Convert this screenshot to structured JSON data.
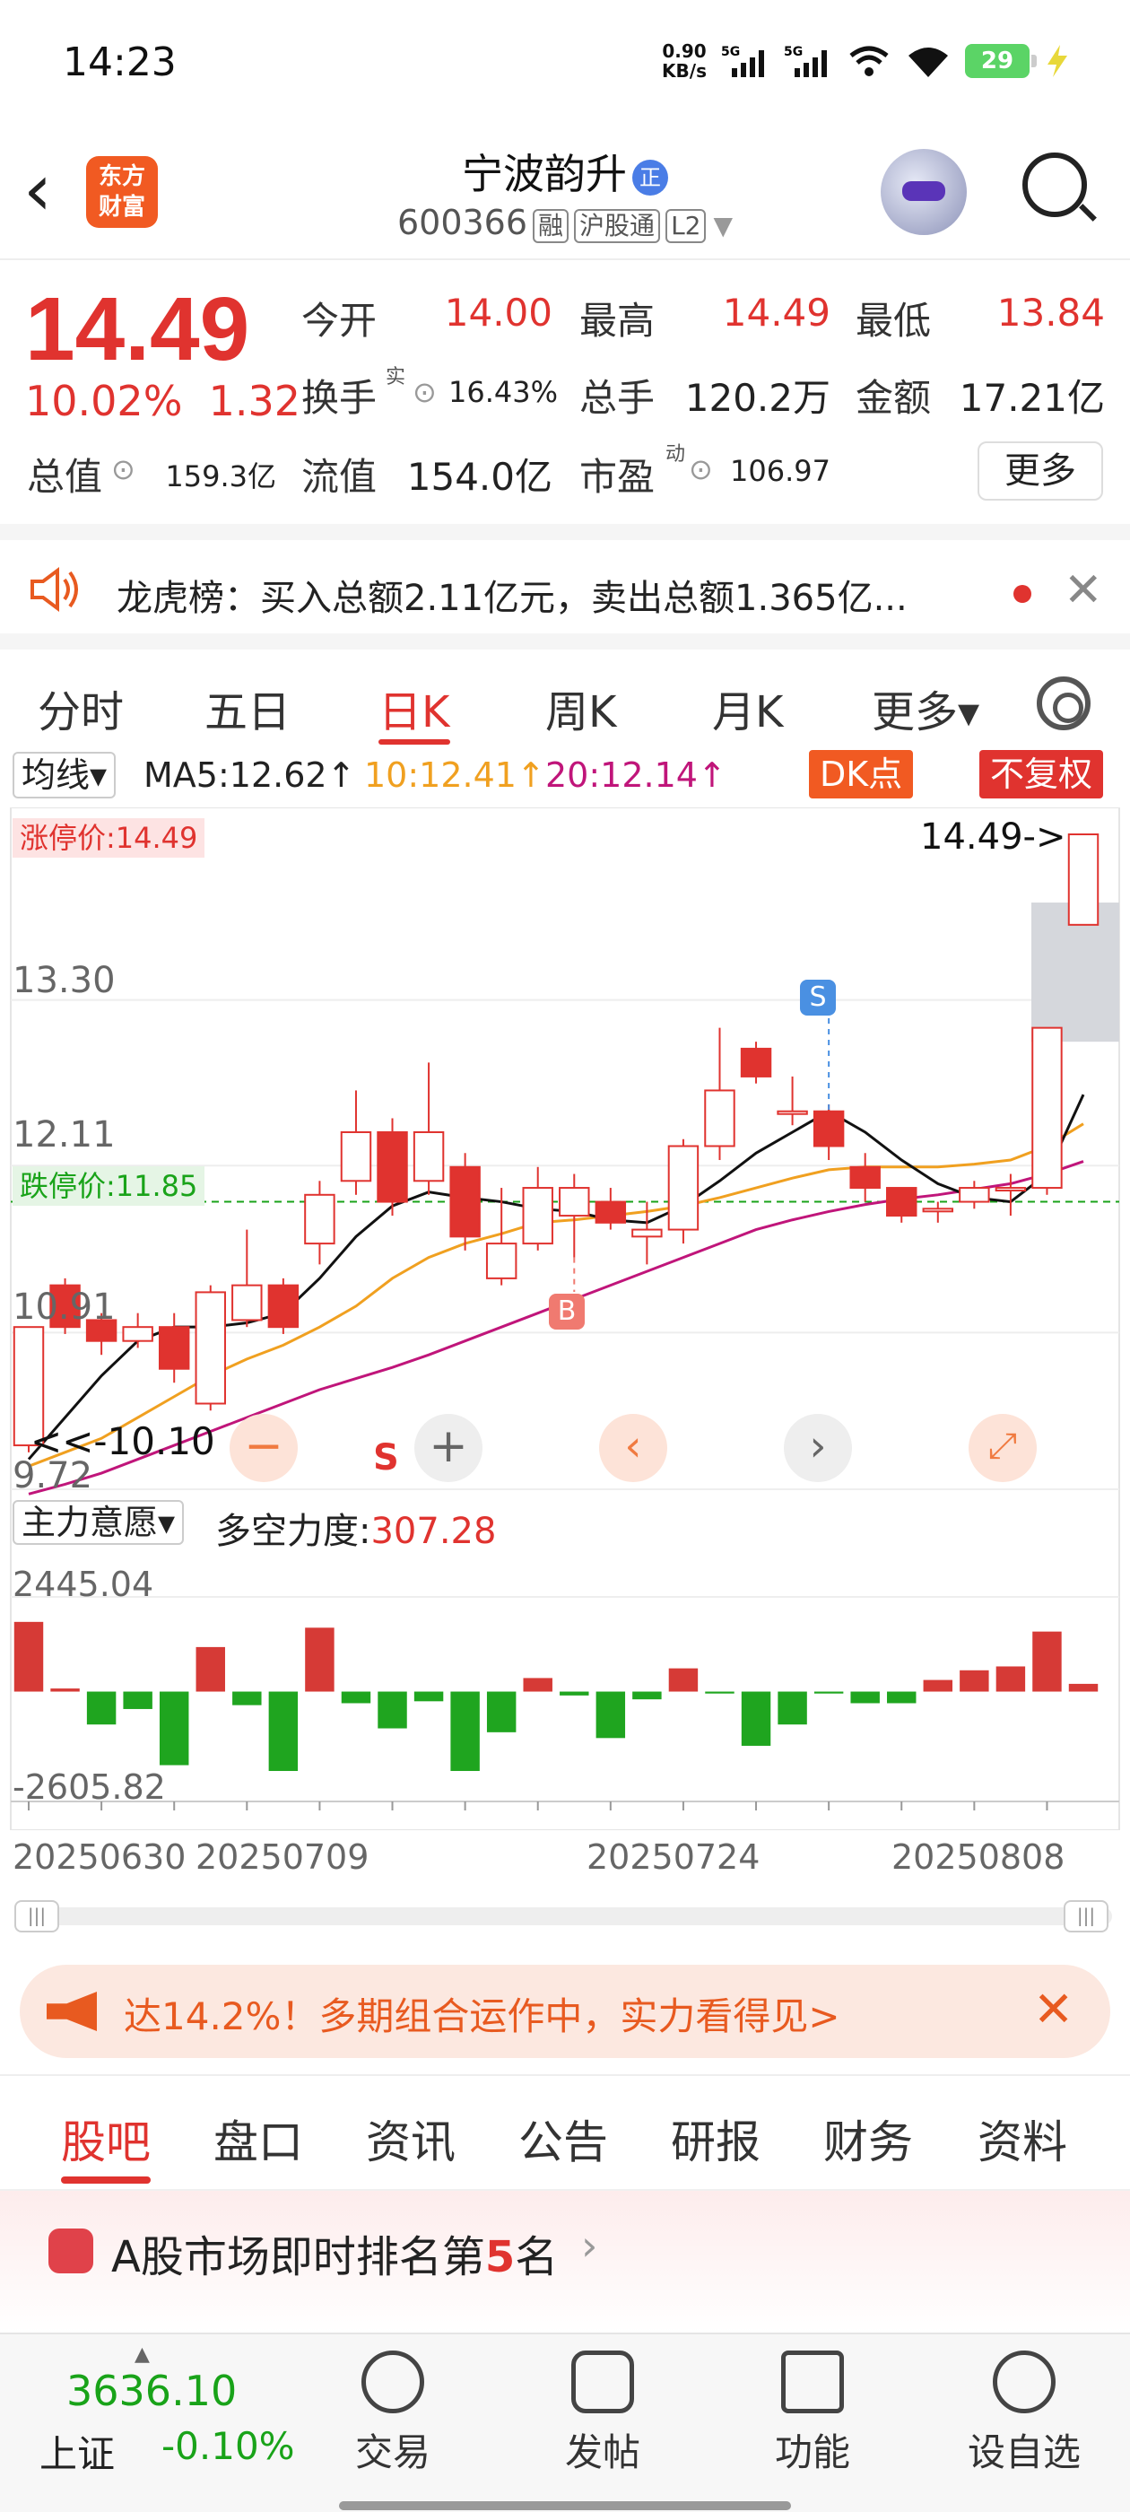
{
  "status_bar": {
    "time": "14:23",
    "net_speed": "0.90\nKB/s",
    "battery": "29"
  },
  "header": {
    "logo_text": "东方\n财富",
    "stock_name": "宁波韵升",
    "name_badge": "正",
    "stock_code": "600366",
    "tags": [
      "融",
      "沪股通",
      "L2"
    ]
  },
  "quote": {
    "price": "14.49",
    "change_pct": "10.02%",
    "change": "1.32",
    "open_label": "今开",
    "open": "14.00",
    "high_label": "最高",
    "high": "14.49",
    "low_label": "最低",
    "low": "13.84",
    "turnover_label": "换手",
    "turnover_sup": "实",
    "turnover": "16.43%",
    "volume_label": "总手",
    "volume": "120.2万",
    "amount_label": "金额",
    "amount": "17.21亿",
    "mktcap_label": "总值",
    "mktcap": "159.3亿",
    "float_label": "流值",
    "float": "154.0亿",
    "pe_label": "市盈",
    "pe_sup": "动",
    "pe": "106.97",
    "more": "更多"
  },
  "lhb": {
    "text": "龙虎榜：买入总额2.11亿元，卖出总额1.365亿..."
  },
  "period_tabs": [
    "分时",
    "五日",
    "日K",
    "周K",
    "月K",
    "更多▾"
  ],
  "period_active": "日K",
  "chart_toolbar": {
    "ma_select": "均线▾",
    "ma5": "MA5:12.62↑",
    "ma10": "10:12.41↑",
    "ma20": "20:12.14↑",
    "dk": "DK点",
    "fq": "不复权"
  },
  "chart_labels": {
    "limit_up": "涨停价:14.49",
    "limit_down": "跌停价:11.85",
    "last_price": "14.49->",
    "low_mark": "<<-10.10",
    "y_ticks": [
      "13.30",
      "12.11",
      "10.91",
      "9.72"
    ],
    "signal_s": "S",
    "signal_b": "B",
    "s_below": "S"
  },
  "indicator": {
    "select": "主力意愿▾",
    "label": "多空力度:",
    "value": "307.28",
    "ymax": "2445.04",
    "ymin": "-2605.82",
    "dates": [
      "20250630",
      "20250709",
      "20250724",
      "20250808"
    ]
  },
  "chart_data": {
    "type": "candlestick",
    "ylim": [
      9.72,
      14.49
    ],
    "candles": [
      {
        "o": 10.1,
        "c": 10.95,
        "h": 10.95,
        "l": 10.05
      },
      {
        "o": 11.25,
        "c": 10.95,
        "h": 11.3,
        "l": 10.9
      },
      {
        "o": 11.0,
        "c": 10.85,
        "h": 11.05,
        "l": 10.75
      },
      {
        "o": 10.85,
        "c": 10.95,
        "h": 11.05,
        "l": 10.8
      },
      {
        "o": 10.95,
        "c": 10.65,
        "h": 11.05,
        "l": 10.55
      },
      {
        "o": 10.4,
        "c": 11.2,
        "h": 11.25,
        "l": 10.35
      },
      {
        "o": 11.0,
        "c": 11.25,
        "h": 11.65,
        "l": 10.95
      },
      {
        "o": 11.25,
        "c": 10.95,
        "h": 11.3,
        "l": 10.9
      },
      {
        "o": 11.55,
        "c": 11.9,
        "h": 12.0,
        "l": 11.4
      },
      {
        "o": 12.0,
        "c": 12.35,
        "h": 12.65,
        "l": 11.9
      },
      {
        "o": 12.35,
        "c": 11.85,
        "h": 12.45,
        "l": 11.75
      },
      {
        "o": 12.0,
        "c": 12.35,
        "h": 12.85,
        "l": 11.9
      },
      {
        "o": 12.1,
        "c": 11.6,
        "h": 12.2,
        "l": 11.5
      },
      {
        "o": 11.3,
        "c": 11.55,
        "h": 11.95,
        "l": 11.25
      },
      {
        "o": 11.55,
        "c": 11.95,
        "h": 12.1,
        "l": 11.5
      },
      {
        "o": 11.75,
        "c": 11.95,
        "h": 12.05,
        "l": 11.45
      },
      {
        "o": 11.85,
        "c": 11.7,
        "h": 11.95,
        "l": 11.65
      },
      {
        "o": 11.6,
        "c": 11.65,
        "h": 11.85,
        "l": 11.4
      },
      {
        "o": 11.65,
        "c": 12.25,
        "h": 12.3,
        "l": 11.55
      },
      {
        "o": 12.25,
        "c": 12.65,
        "h": 13.1,
        "l": 12.15
      },
      {
        "o": 12.95,
        "c": 12.75,
        "h": 13.0,
        "l": 12.7
      },
      {
        "o": 12.5,
        "c": 12.5,
        "h": 12.75,
        "l": 12.4
      },
      {
        "o": 12.5,
        "c": 12.25,
        "h": 12.55,
        "l": 12.15
      },
      {
        "o": 12.1,
        "c": 11.95,
        "h": 12.2,
        "l": 11.85
      },
      {
        "o": 11.95,
        "c": 11.75,
        "h": 11.95,
        "l": 11.7
      },
      {
        "o": 11.8,
        "c": 11.8,
        "h": 11.85,
        "l": 11.7
      },
      {
        "o": 11.85,
        "c": 11.95,
        "h": 12.0,
        "l": 11.8
      },
      {
        "o": 11.95,
        "c": 11.95,
        "h": 12.05,
        "l": 11.75
      },
      {
        "o": 11.95,
        "c": 13.1,
        "h": 13.1,
        "l": 11.9
      },
      {
        "o": 13.84,
        "c": 14.49,
        "h": 14.49,
        "l": 13.84
      }
    ],
    "ma5": [
      10.0,
      10.3,
      10.6,
      10.85,
      10.95,
      10.95,
      10.98,
      11.05,
      11.3,
      11.6,
      11.82,
      11.92,
      11.88,
      11.85,
      11.8,
      11.78,
      11.72,
      11.7,
      11.82,
      12.0,
      12.2,
      12.35,
      12.5,
      12.35,
      12.15,
      11.98,
      11.88,
      11.85,
      12.05,
      12.62
    ],
    "ma10": [
      9.95,
      10.05,
      10.15,
      10.3,
      10.45,
      10.6,
      10.72,
      10.82,
      10.95,
      11.1,
      11.3,
      11.45,
      11.55,
      11.62,
      11.7,
      11.72,
      11.75,
      11.78,
      11.82,
      11.88,
      11.95,
      12.02,
      12.08,
      12.1,
      12.1,
      12.1,
      12.12,
      12.15,
      12.25,
      12.41
    ],
    "ma20": [
      9.75,
      9.82,
      9.9,
      10.0,
      10.1,
      10.2,
      10.3,
      10.4,
      10.5,
      10.58,
      10.66,
      10.75,
      10.85,
      10.95,
      11.05,
      11.15,
      11.25,
      11.35,
      11.45,
      11.55,
      11.65,
      11.72,
      11.78,
      11.83,
      11.87,
      11.9,
      11.94,
      11.98,
      12.05,
      12.14
    ],
    "indicator_values": [
      1800,
      80,
      -850,
      -450,
      -1900,
      1150,
      -350,
      -2050,
      1650,
      -300,
      -950,
      -250,
      -2050,
      -1050,
      350,
      -100,
      -1200,
      -200,
      600,
      -50,
      -1400,
      -850,
      -50,
      -300,
      -300,
      300,
      550,
      650,
      1550,
      200
    ],
    "indicator_ylim": [
      -2605.82,
      2445.04
    ]
  },
  "ad": {
    "text": "达14.2%！多期组合运作中，实力看得见>"
  },
  "sub_tabs": [
    "股吧",
    "盘口",
    "资讯",
    "公告",
    "研报",
    "财务",
    "资料"
  ],
  "rank": {
    "prefix": "A股市场即时排名第",
    "number": "5",
    "suffix": "名"
  },
  "bottom_nav": {
    "index_value": "3636.10",
    "index_name": "上证",
    "index_change": "-0.10%",
    "items": [
      "交易",
      "发帖",
      "功能",
      "设自选"
    ]
  }
}
